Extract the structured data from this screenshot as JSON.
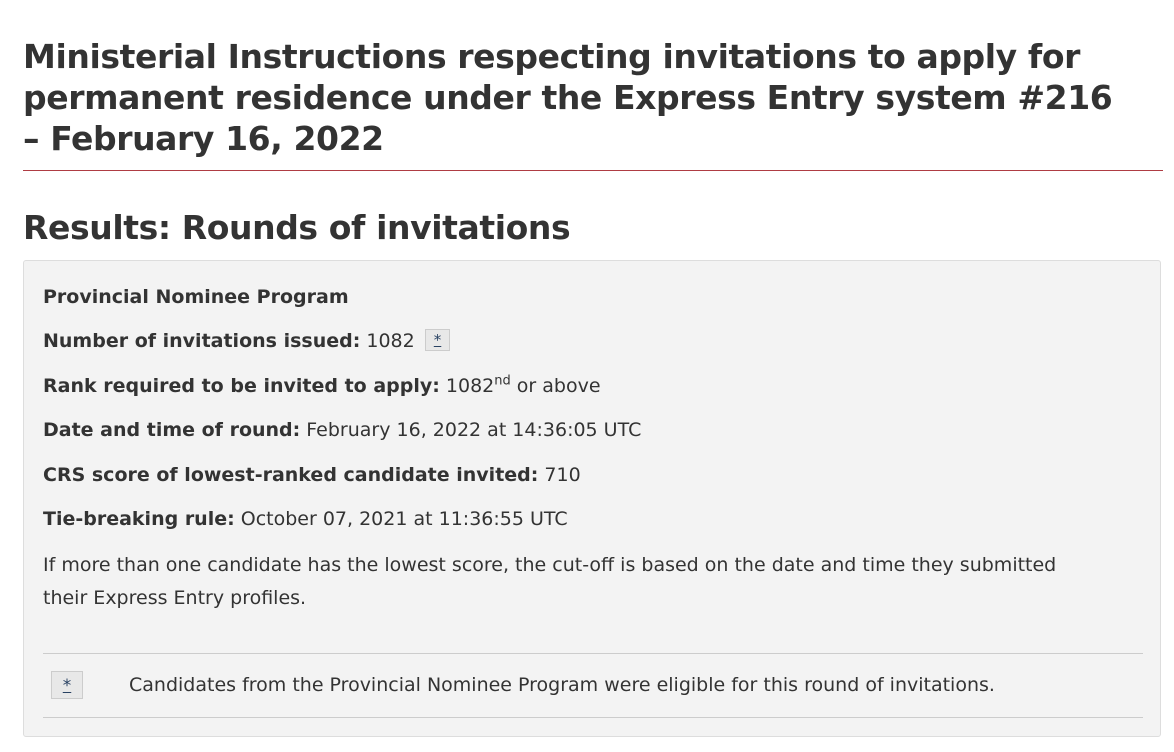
{
  "page_title": "Ministerial Instructions respecting invitations to apply for permanent residence under the Express Entry system #216 – February 16, 2022",
  "section_title": "Results: Rounds of invitations",
  "results": {
    "program": "Provincial Nominee Program",
    "invitations_label": "Number of invitations issued:",
    "invitations_value": "1082",
    "footnote_ref": "*",
    "rank_label": "Rank required to be invited to apply:",
    "rank_value": "1082",
    "rank_suffix": "nd",
    "rank_tail": "or above",
    "date_label": "Date and time of round:",
    "date_value": "February 16, 2022 at 14:36:05 UTC",
    "crs_label": "CRS score of lowest-ranked candidate invited:",
    "crs_value": "710",
    "tie_label": "Tie-breaking rule:",
    "tie_value": "October 07, 2021 at 11:36:55 UTC",
    "tie_note": "If more than one candidate has the lowest score, the cut-off is based on the date and time they submitted their Express Entry profiles."
  },
  "footnote": {
    "back_link": "*",
    "text": "Candidates from the Provincial Nominee Program were eligible for this round of invitations."
  },
  "colors": {
    "title_rule": "#af3c43",
    "box_background": "#f3f3f3",
    "link": "#284162"
  }
}
